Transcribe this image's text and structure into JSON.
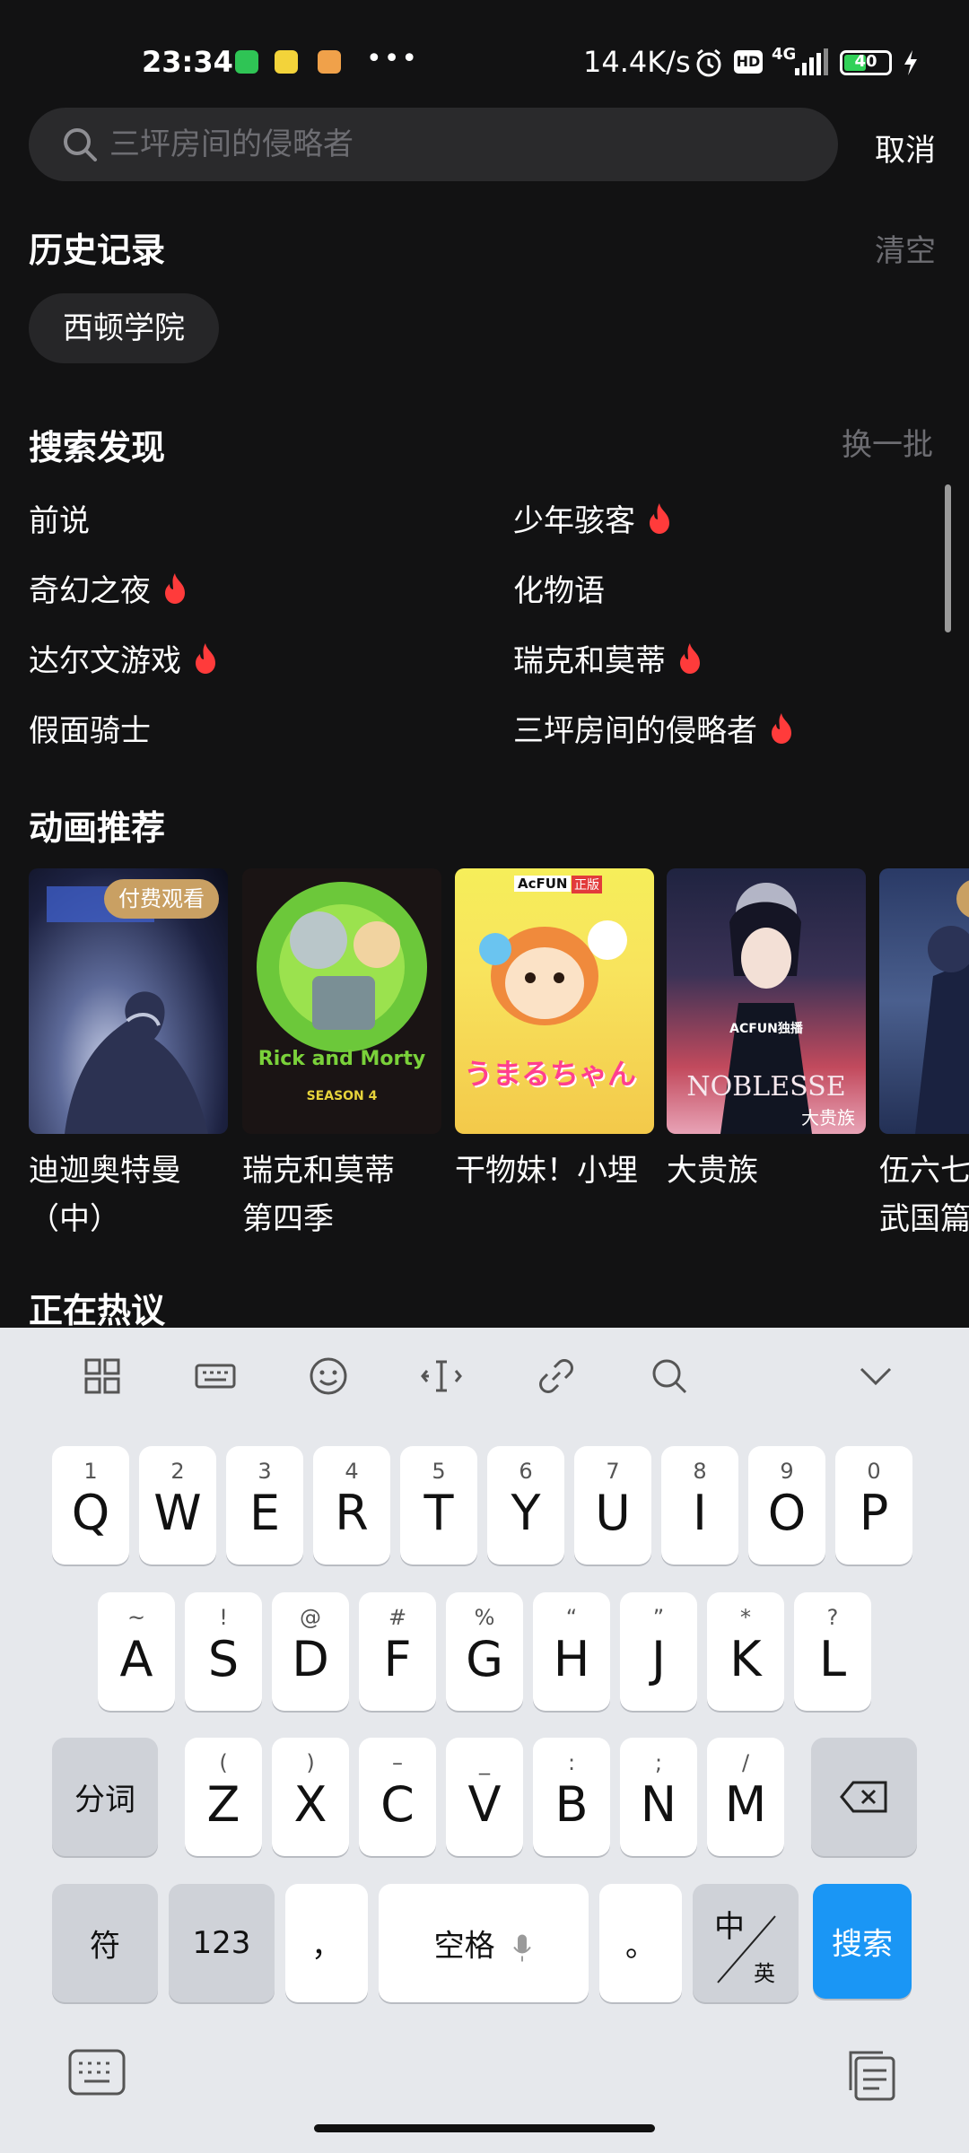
{
  "status_bar": {
    "time": "23:34",
    "dots": "•••",
    "net_speed": "14.4K/s",
    "hd": "HD",
    "network": "4G",
    "battery": "40"
  },
  "search": {
    "placeholder": "三坪房间的侵略者",
    "cancel": "取消"
  },
  "history": {
    "title": "历史记录",
    "clear": "清空",
    "items": [
      "西顿学院"
    ]
  },
  "discover": {
    "title": "搜索发现",
    "refresh": "换一批",
    "items": [
      {
        "label": "前说",
        "hot": false
      },
      {
        "label": "少年骇客",
        "hot": true
      },
      {
        "label": "奇幻之夜",
        "hot": true
      },
      {
        "label": "化物语",
        "hot": false
      },
      {
        "label": "达尔文游戏",
        "hot": true
      },
      {
        "label": "瑞克和莫蒂",
        "hot": true
      },
      {
        "label": "假面骑士",
        "hot": false
      },
      {
        "label": "三坪房间的侵略者",
        "hot": true
      }
    ]
  },
  "anime": {
    "title": "动画推荐",
    "cards": [
      {
        "title_line1": "迪迦奥特曼",
        "title_line2": "（中）",
        "badge": "付费观看"
      },
      {
        "title_line1": "瑞克和莫蒂",
        "title_line2": "第四季",
        "badge": ""
      },
      {
        "title_line1": "干物妹！小埋",
        "title_line2": "",
        "badge": ""
      },
      {
        "title_line1": "大贵族",
        "title_line2": "",
        "badge": ""
      },
      {
        "title_line1": "伍六七",
        "title_line2": "武国篇",
        "badge": ""
      }
    ],
    "poster_texts": {
      "rick": "Rick and Morty",
      "season": "SEASON 4",
      "umaru_logo": "AcFUN",
      "umaru_tag": "正版",
      "umaru_title": "うまるちゃん",
      "noblesse": "NOBLESSE",
      "noblesse_logo": "ACFUN独播",
      "noblesse_cn": "大贵族"
    }
  },
  "trending": {
    "title": "正在热议"
  },
  "keyboard": {
    "row1": [
      {
        "k": "Q",
        "s": "1"
      },
      {
        "k": "W",
        "s": "2"
      },
      {
        "k": "E",
        "s": "3"
      },
      {
        "k": "R",
        "s": "4"
      },
      {
        "k": "T",
        "s": "5"
      },
      {
        "k": "Y",
        "s": "6"
      },
      {
        "k": "U",
        "s": "7"
      },
      {
        "k": "I",
        "s": "8"
      },
      {
        "k": "O",
        "s": "9"
      },
      {
        "k": "P",
        "s": "0"
      }
    ],
    "row2": [
      {
        "k": "A",
        "s": "~"
      },
      {
        "k": "S",
        "s": "!"
      },
      {
        "k": "D",
        "s": "@"
      },
      {
        "k": "F",
        "s": "#"
      },
      {
        "k": "G",
        "s": "%"
      },
      {
        "k": "H",
        "s": "“"
      },
      {
        "k": "J",
        "s": "”"
      },
      {
        "k": "K",
        "s": "*"
      },
      {
        "k": "L",
        "s": "?"
      }
    ],
    "row3": [
      {
        "k": "Z",
        "s": "("
      },
      {
        "k": "X",
        "s": ")"
      },
      {
        "k": "C",
        "s": "–"
      },
      {
        "k": "V",
        "s": "_"
      },
      {
        "k": "B",
        "s": ":"
      },
      {
        "k": "N",
        "s": ";"
      },
      {
        "k": "M",
        "s": "/"
      }
    ],
    "segment": "分词",
    "symbols": "符",
    "numbers": "123",
    "comma": "，",
    "space": "空格",
    "period": "。",
    "lang_main": "中",
    "lang_sub": "英",
    "search": "搜索"
  }
}
